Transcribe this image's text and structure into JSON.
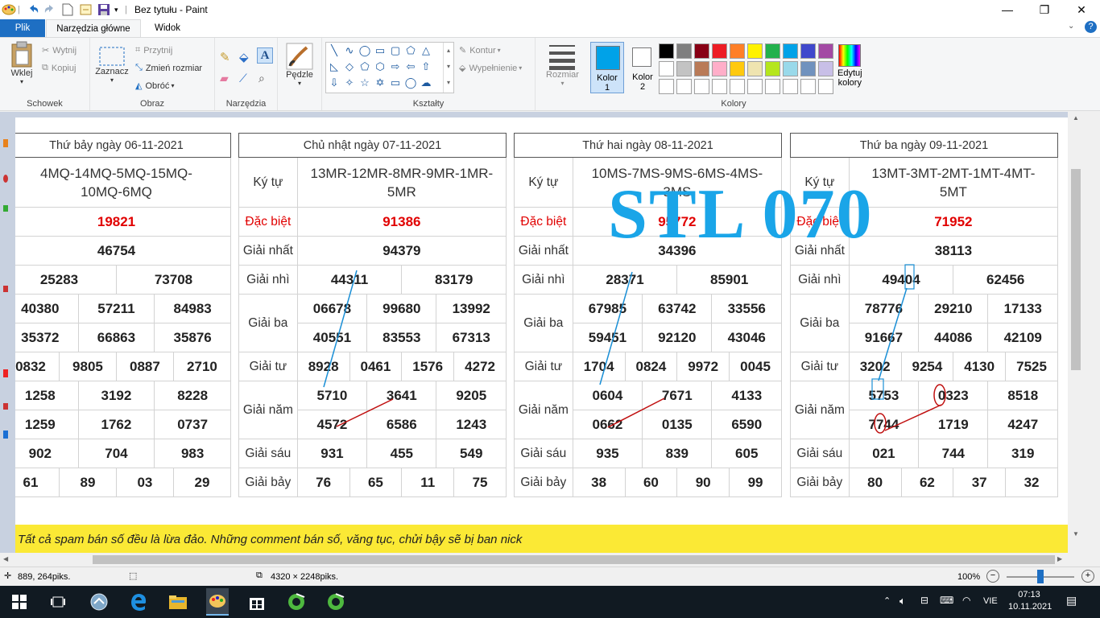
{
  "window": {
    "title": "Bez tytułu - Paint",
    "controls": {
      "minimize": "—",
      "maximize": "❐",
      "close": "✕"
    }
  },
  "tabs": [
    {
      "label": "Plik"
    },
    {
      "label": "Narzędzia główne"
    },
    {
      "label": "Widok"
    }
  ],
  "ribbon": {
    "clipboard": {
      "paste": "Wklej",
      "cut": "Wytnij",
      "copy": "Kopiuj",
      "group": "Schowek"
    },
    "image": {
      "select": "Zaznacz",
      "crop": "Przytnij",
      "resize": "Zmień rozmiar",
      "rotate": "Obróć",
      "group": "Obraz"
    },
    "tools": {
      "group": "Narzędzia"
    },
    "brushes": {
      "label": "Pędzle"
    },
    "shapes": {
      "outline": "Kontur",
      "fill": "Wypełnienie",
      "group": "Kształty"
    },
    "size": {
      "label": "Rozmiar"
    },
    "colors": {
      "color1": "Kolor",
      "color1_num": "1",
      "color2": "Kolor",
      "color2_num": "2",
      "edit": "Edytuj",
      "edit2": "kolory",
      "group": "Kolory"
    },
    "palette": [
      "#000000",
      "#7f7f7f",
      "#880015",
      "#ed1c24",
      "#ff7f27",
      "#fff200",
      "#22b14c",
      "#00a2e8",
      "#3f48cc",
      "#a349a4",
      "#ffffff",
      "#c3c3c3",
      "#b97a57",
      "#ffaec9",
      "#ffc90e",
      "#efe4b0",
      "#b5e61d",
      "#99d9ea",
      "#7092be",
      "#c8bfe7"
    ]
  },
  "canvas": {
    "watermark": "STL 070",
    "spam_text": "Tất cả spam bán số đều là lừa đảo. Những comment bán số, văng tục, chửi bậy sẽ bị ban nick",
    "tables": [
      {
        "header": "Thứ bảy ngày 06-11-2021",
        "code_line1": "4MQ-14MQ-5MQ-15MQ-",
        "code_line2": "10MQ-6MQ",
        "db": "19821",
        "g1": "46754",
        "g2": [
          "25283",
          "73708"
        ],
        "g3a": [
          "40380",
          "57211",
          "84983"
        ],
        "g3b": [
          "35372",
          "66863",
          "35876"
        ],
        "g4": [
          "0832",
          "9805",
          "0887",
          "2710"
        ],
        "g5a": [
          "1258",
          "3192",
          "8228"
        ],
        "g5b": [
          "1259",
          "1762",
          "0737"
        ],
        "g6": [
          "902",
          "704",
          "983"
        ],
        "g7": [
          "61",
          "89",
          "03",
          "29"
        ]
      },
      {
        "header": "Chủ nhật ngày 07-11-2021",
        "code_label": "Ký tự",
        "code_line1": "13MR-12MR-8MR-9MR-1MR-",
        "code_line2": "5MR",
        "labels": {
          "db": "Đặc biệt",
          "g1": "Giải nhất",
          "g2": "Giải nhì",
          "g3": "Giải ba",
          "g4": "Giải tư",
          "g5": "Giải năm",
          "g6": "Giải sáu",
          "g7": "Giải bảy"
        },
        "db": "91386",
        "g1": "94379",
        "g2": [
          "44311",
          "83179"
        ],
        "g3a": [
          "06678",
          "99680",
          "13992"
        ],
        "g3b": [
          "40551",
          "83553",
          "67313"
        ],
        "g4": [
          "8928",
          "0461",
          "1576",
          "4272"
        ],
        "g5a": [
          "5710",
          "3641",
          "9205"
        ],
        "g5b": [
          "4572",
          "6586",
          "1243"
        ],
        "g6": [
          "931",
          "455",
          "549"
        ],
        "g7": [
          "76",
          "65",
          "11",
          "75"
        ]
      },
      {
        "header": "Thứ hai ngày 08-11-2021",
        "code_label": "Ký tự",
        "code_line1": "10MS-7MS-9MS-6MS-4MS-",
        "code_line2": "3MS",
        "labels": {
          "db": "Đặc biệt",
          "g1": "Giải nhất",
          "g2": "Giải nhì",
          "g3": "Giải ba",
          "g4": "Giải tư",
          "g5": "Giải năm",
          "g6": "Giải sáu",
          "g7": "Giải bảy"
        },
        "db": "95772",
        "g1": "34396",
        "g2": [
          "28371",
          "85901"
        ],
        "g3a": [
          "67985",
          "63742",
          "33556"
        ],
        "g3b": [
          "59451",
          "92120",
          "43046"
        ],
        "g4": [
          "1704",
          "0824",
          "9972",
          "0045"
        ],
        "g5a": [
          "0604",
          "7671",
          "4133"
        ],
        "g5b": [
          "0662",
          "0135",
          "6590"
        ],
        "g6": [
          "935",
          "839",
          "605"
        ],
        "g7": [
          "38",
          "60",
          "90",
          "99"
        ]
      },
      {
        "header": "Thứ ba ngày 09-11-2021",
        "code_label": "Ký tự",
        "code_line1": "13MT-3MT-2MT-1MT-4MT-",
        "code_line2": "5MT",
        "labels": {
          "db": "Đặc biệt",
          "g1": "Giải nhất",
          "g2": "Giải nhì",
          "g3": "Giải ba",
          "g4": "Giải tư",
          "g5": "Giải năm",
          "g6": "Giải sáu",
          "g7": "Giải bảy"
        },
        "db": "71952",
        "g1": "38113",
        "g2": [
          "49404",
          "62456"
        ],
        "g3a": [
          "78776",
          "29210",
          "17133"
        ],
        "g3b": [
          "91667",
          "44086",
          "42109"
        ],
        "g4": [
          "3202",
          "9254",
          "4130",
          "7525"
        ],
        "g5a": [
          "5753",
          "0323",
          "8518"
        ],
        "g5b": [
          "7744",
          "1719",
          "4247"
        ],
        "g6": [
          "021",
          "744",
          "319"
        ],
        "g7": [
          "80",
          "62",
          "37",
          "32"
        ]
      }
    ]
  },
  "status": {
    "cursor_pos": "889, 264piks.",
    "image_size": "4320 × 2248piks.",
    "zoom": "100%",
    "zoom_percent": 100
  },
  "taskbar": {
    "language": "VIE",
    "time": "07:13",
    "date": "10.11.2021"
  }
}
